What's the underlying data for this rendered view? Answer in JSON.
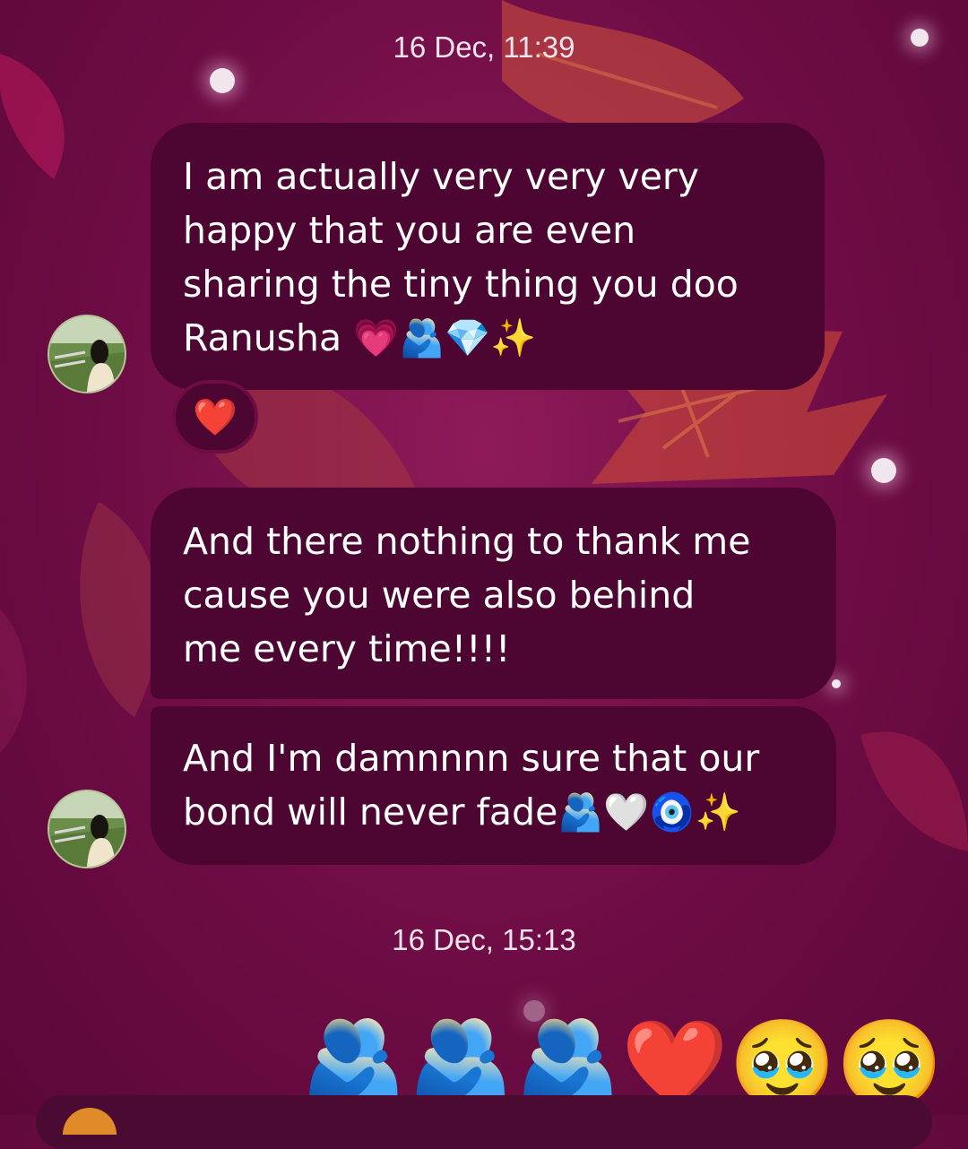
{
  "thread": {
    "timestamp_1": "16 Dec, 11:39",
    "timestamp_2": "16 Dec, 15:13",
    "messages": [
      {
        "text": "I am actually very very very\nhappy that you are even\nsharing the tiny thing you doo\nRanusha 💗🫂💎✨"
      },
      {
        "text": "And there nothing to thank me\ncause you were also behind\nme every time!!!!"
      },
      {
        "text": "And I'm damnnnn sure that our\nbond will never fade🫂🤍🧿✨"
      }
    ],
    "reaction": "❤️",
    "big_emoji_message": "🫂🫂🫂❤️🥹🥹"
  },
  "colors": {
    "background": "#6e0c45",
    "bubble": "#4c0631",
    "timestamp_text": "#f3e4ec"
  },
  "icons": {
    "avatar": "avatar-photo",
    "reaction": "heart-reaction"
  }
}
